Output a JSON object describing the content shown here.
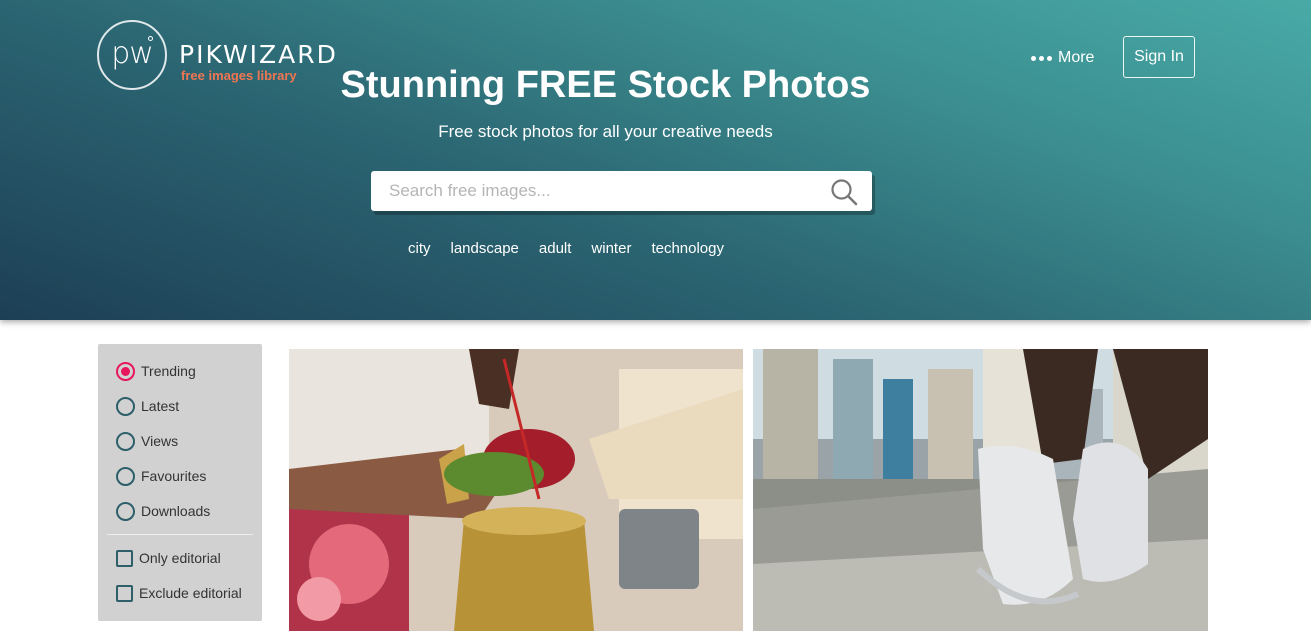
{
  "brand": {
    "logo_mark": "pw",
    "name": "PIKWIZARD",
    "tagline": "free images library"
  },
  "nav": {
    "more_label": "More",
    "signin_label": "Sign In"
  },
  "hero": {
    "headline_pre": "Stunning ",
    "headline_bold": "FREE",
    "headline_post": " Stock Photos",
    "subheadline": "Free stock photos for all your creative needs"
  },
  "search": {
    "placeholder": "Search free images...",
    "value": ""
  },
  "tags": [
    "city",
    "landscape",
    "adult",
    "winter",
    "technology"
  ],
  "filters": {
    "sort": [
      {
        "label": "Trending",
        "checked": true
      },
      {
        "label": "Latest",
        "checked": false
      },
      {
        "label": "Views",
        "checked": false
      },
      {
        "label": "Favourites",
        "checked": false
      },
      {
        "label": "Downloads",
        "checked": false
      }
    ],
    "editorial": [
      {
        "label": "Only editorial",
        "checked": false
      },
      {
        "label": "Exclude editorial",
        "checked": false
      }
    ]
  },
  "photos": [
    {
      "subject": "wedding-ritual-hands-pot"
    },
    {
      "subject": "sneakers-chain-link-fence-city"
    }
  ],
  "colors": {
    "accent_radio": "#e8175d",
    "logo_tagline": "#f07652",
    "control_outline": "#2d5f6a"
  }
}
